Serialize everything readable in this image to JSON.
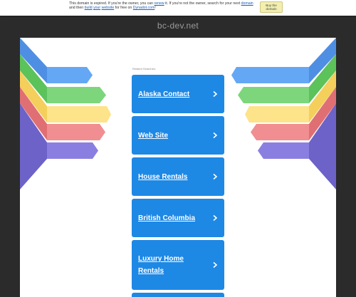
{
  "notice": {
    "before": "This domain is expired. If you're the owner, you can ",
    "renew": "renew",
    "middle": " it. If you're not the owner, search for your next ",
    "domain": "domain",
    "and_then": " and then ",
    "build": "build",
    "your_word": " ",
    "your": "your",
    "space2": " ",
    "website": "website",
    "free": " for free on ",
    "dynadot": "Dynadot.com",
    "end": "!"
  },
  "buy_button": "Buy the domain",
  "site_title": "bc-dev.net",
  "related_label": "Related Searches:",
  "links": [
    {
      "label": "Alaska Contact"
    },
    {
      "label": "Web Site"
    },
    {
      "label": "House Rentals"
    },
    {
      "label": "British Columbia"
    },
    {
      "label": "Luxury Home Rentals"
    }
  ],
  "colors": {
    "background": "#2b2b2b",
    "panel": "#ffffff",
    "link_button": "#1e88e5",
    "ribbon_blue": "#64a8f5",
    "ribbon_green": "#7ed67c",
    "ribbon_yellow": "#fde38a",
    "ribbon_red": "#f08e91",
    "ribbon_purple": "#8a7fe0"
  }
}
